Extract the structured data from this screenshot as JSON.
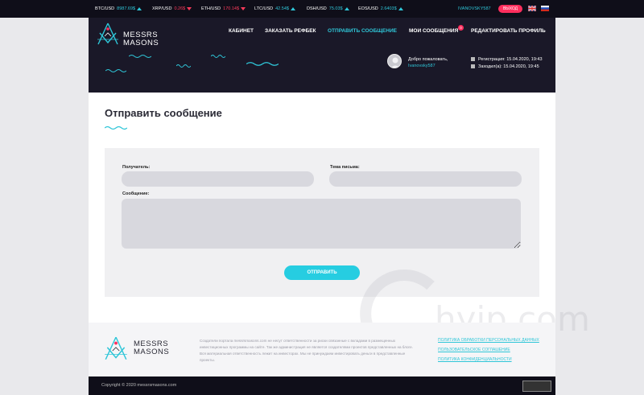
{
  "ticker": [
    {
      "pair": "BTC/USD",
      "value": "8987.69$",
      "dir": "up"
    },
    {
      "pair": "XRP/USD",
      "value": "0.26$",
      "dir": "down"
    },
    {
      "pair": "ETH/USD",
      "value": "170.14$",
      "dir": "down"
    },
    {
      "pair": "LTC/USD",
      "value": "42.54$",
      "dir": "up"
    },
    {
      "pair": "DSH/USD",
      "value": "75.03$",
      "dir": "up"
    },
    {
      "pair": "EOS/USD",
      "value": "2.6403$",
      "dir": "up"
    }
  ],
  "user": {
    "username": "IVANOVSKY587",
    "logout_label": "ВЫХОД"
  },
  "brand": {
    "line1": "MESSRS",
    "line2": "MASONS"
  },
  "nav": {
    "cabinet": "КАБИНЕТ",
    "order_refback": "ЗАКАЗАТЬ РЕФБЕК",
    "send_message": "ОТПРАВИТЬ СООБЩЕНИЕ",
    "my_messages": "МОИ СООБЩЕНИЯ",
    "my_messages_badge": "0",
    "edit_profile": "РЕДАКТИРОВАТЬ ПРОФИЛЬ"
  },
  "welcome": {
    "greeting": "Добро пожаловать,",
    "nick": "Ivanovsky587"
  },
  "dates": {
    "registration": "Регистрация: 15.04.2020, 19:43",
    "last_login": "Заходил(а): 15.04.2020, 19:45"
  },
  "page_title": "Отправить сообщение",
  "form": {
    "recipient_label": "Получатель:",
    "subject_label": "Тема письма:",
    "message_label": "Сообщение:",
    "send_label": "ОТПРАВИТЬ"
  },
  "footer": {
    "disclaimer": "Создатели портала messrsmasons.com не несут ответственности за риски связанные с вкладами в размещенных инвестиционных программы на сайте. Так же администрация не является создателями проектов представленных на блоге. Вся материальная ответственность лежит на инвесторах. Мы не принуждаем инвестировать деньги в представленные проекты.",
    "links": [
      "ПОЛИТИКА ОБРАБОТКИ ПЕРСОНАЛЬНЫХ ДАННЫХ",
      "ПОЛЬЗОВАТЕЛЬСКОЕ СОГЛАШЕНИЕ",
      "ПОЛИТИКА КОНФИДЕНЦИАЛЬНОСТИ"
    ],
    "copyright": "Copyright © 2020 messrsmasons.com"
  },
  "watermark": "hyip.com",
  "colors": {
    "accent": "#2fc6d8",
    "danger": "#ff2e5d",
    "header_bg": "#1a1828",
    "topbar_bg": "#0f0e19"
  }
}
